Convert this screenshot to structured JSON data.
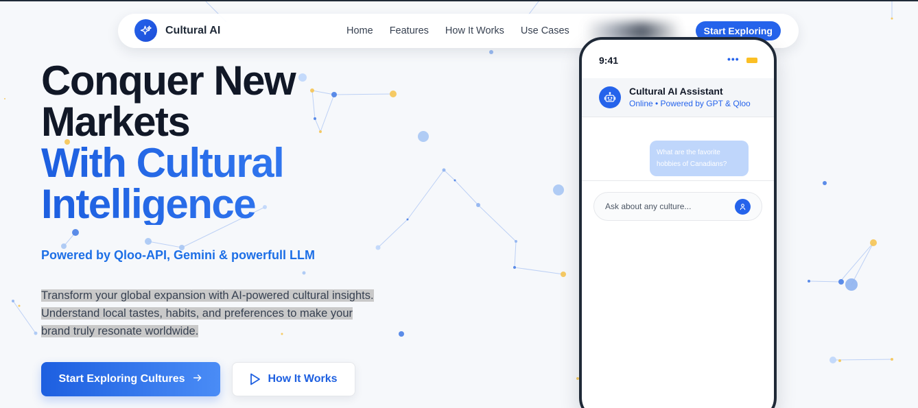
{
  "brand": {
    "name": "Cultural AI",
    "logo_icon": "sparkles-icon"
  },
  "nav": {
    "links": [
      "Home",
      "Features",
      "How It Works",
      "Use Cases"
    ],
    "cta_label": "Start Exploring"
  },
  "hero": {
    "title_line1": "Conquer New",
    "title_line2": "Markets",
    "title_line3": "With Cultural",
    "title_line4": "Intelligence",
    "subtitle": "Powered by Qloo-API, Gemini & powerfull LLM",
    "desc_line1": "Transform your global expansion with AI-powered cultural insights.",
    "desc_line2": "Understand local tastes, habits, and preferences to make your",
    "desc_line3": "brand truly resonate worldwide.",
    "primary_button": "Start Exploring Cultures",
    "secondary_button": "How It Works"
  },
  "phone": {
    "time": "9:41",
    "status_dots": "•••",
    "assistant_name": "Cultural AI Assistant",
    "assistant_status": "Online • Powered by GPT & Qloo",
    "user_message": "What are the favorite hobbies of Canadians?",
    "input_placeholder": "Ask about any culture..."
  },
  "colors": {
    "accent": "#2563eb",
    "accent_light": "#3b82f6",
    "heading": "#111827",
    "network_gold": "#f6c453",
    "network_blue": "#4a7fe6"
  }
}
